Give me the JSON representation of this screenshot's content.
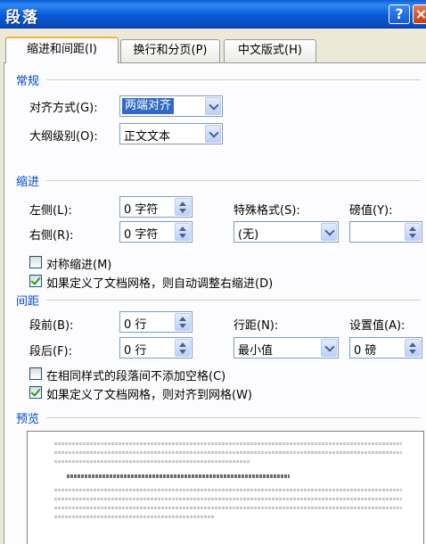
{
  "window": {
    "title": "段落",
    "help_label": "?",
    "close_label": "×"
  },
  "tabs": [
    {
      "label": "缩进和间距(I)",
      "active": true
    },
    {
      "label": "换行和分页(P)",
      "active": false
    },
    {
      "label": "中文版式(H)",
      "active": false
    }
  ],
  "general": {
    "heading": "常规",
    "alignment_label": "对齐方式(G):",
    "alignment_value": "两端对齐",
    "outline_label": "大纲级别(O):",
    "outline_value": "正文文本"
  },
  "indent": {
    "heading": "缩进",
    "left_label": "左侧(L):",
    "left_value": "0 字符",
    "right_label": "右侧(R):",
    "right_value": "0 字符",
    "special_label": "特殊格式(S):",
    "special_value": "(无)",
    "by_label": "磅值(Y):",
    "by_value": "",
    "mirror_label": "对称缩进(M)",
    "mirror_checked": false,
    "grid_auto_label": "如果定义了文档网格，则自动调整右缩进(D)",
    "grid_auto_checked": true
  },
  "spacing": {
    "heading": "间距",
    "before_label": "段前(B):",
    "before_value": "0 行",
    "after_label": "段后(F):",
    "after_value": "0 行",
    "line_label": "行距(N):",
    "line_value": "最小值",
    "at_label": "设置值(A):",
    "at_value": "0 磅",
    "no_space_label": "在相同样式的段落间不添加空格(C)",
    "no_space_checked": false,
    "snap_grid_label": "如果定义了文档网格，则对齐到网格(W)",
    "snap_grid_checked": true
  },
  "preview": {
    "heading": "预览"
  },
  "colors": {
    "titlebar": "#0b5ad6",
    "section_heading": "#0046d5",
    "selection": "#316ac5",
    "dialog_bg": "#ece9d8"
  }
}
